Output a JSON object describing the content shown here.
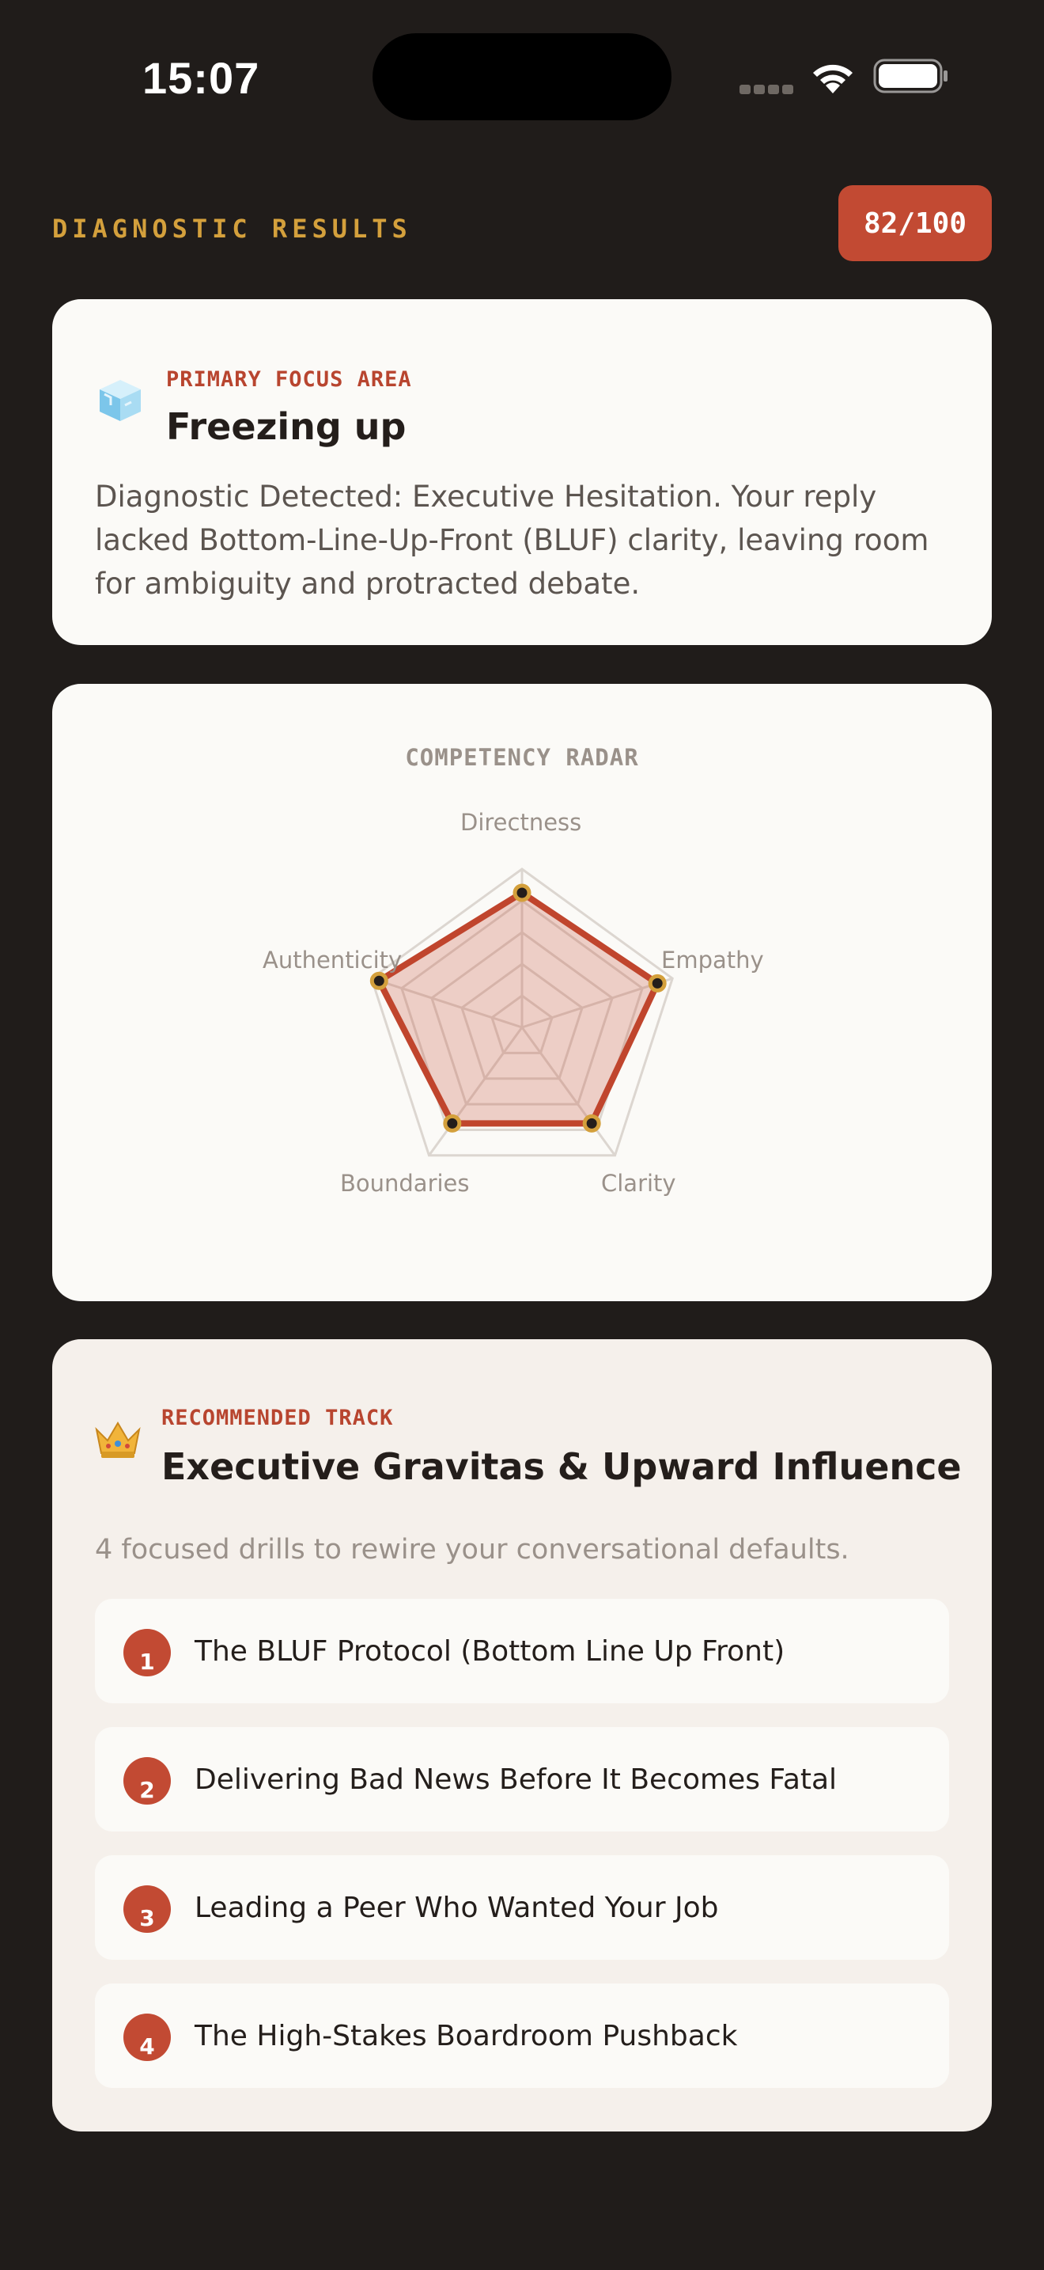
{
  "status": {
    "time": "15:07"
  },
  "header": {
    "title": "DIAGNOSTIC RESULTS",
    "score": "82/100"
  },
  "focus": {
    "kicker": "PRIMARY FOCUS AREA",
    "icon": "ice-cube-icon",
    "title": "Freezing up",
    "description": "Diagnostic Detected: Executive Hesitation. Your reply lacked Bottom-Line-Up-Front (BLUF) clarity, leaving room for ambiguity and protracted debate."
  },
  "radar": {
    "title": "COMPETENCY RADAR",
    "axes": [
      "Directness",
      "Empathy",
      "Clarity",
      "Boundaries",
      "Authenticity"
    ],
    "values": [
      0.85,
      0.9,
      0.75,
      0.75,
      0.95
    ],
    "colors": {
      "fill": "#c24a33",
      "stroke": "#c0452d",
      "point": "#d4a03c",
      "grid": "#dcd6d0"
    }
  },
  "chart_data": {
    "type": "radar",
    "title": "COMPETENCY RADAR",
    "categories": [
      "Directness",
      "Empathy",
      "Clarity",
      "Boundaries",
      "Authenticity"
    ],
    "values": [
      0.85,
      0.9,
      0.75,
      0.75,
      0.95
    ],
    "range": [
      0,
      1
    ],
    "grid": true
  },
  "track": {
    "kicker": "RECOMMENDED TRACK",
    "icon": "crown-icon",
    "title": "Executive Gravitas & Upward Influence",
    "description": "4 focused drills to rewire your conversational defaults.",
    "drills": [
      {
        "num": "1",
        "label": "The BLUF Protocol (Bottom Line Up Front)"
      },
      {
        "num": "2",
        "label": "Delivering Bad News Before It Becomes Fatal"
      },
      {
        "num": "3",
        "label": "Leading a Peer Who Wanted Your Job"
      },
      {
        "num": "4",
        "label": "The High-Stakes Boardroom Pushback"
      }
    ]
  },
  "colors": {
    "accent": "#c24a33",
    "gold": "#d4a03c",
    "background": "#201c1a",
    "card": "#fbfaf7"
  }
}
